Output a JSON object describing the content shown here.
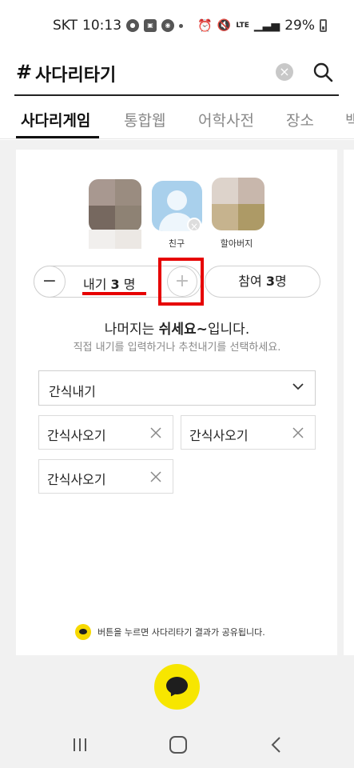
{
  "status_bar": {
    "carrier": "SKT",
    "time": "10:13",
    "network": "LTE",
    "battery": "29%"
  },
  "search": {
    "hash": "#",
    "query": "사다리타기"
  },
  "tabs": [
    {
      "label": "사다리게임",
      "active": true
    },
    {
      "label": "통합웹",
      "active": false
    },
    {
      "label": "어학사전",
      "active": false
    },
    {
      "label": "장소",
      "active": false
    },
    {
      "label": "백",
      "active": false
    }
  ],
  "participants": [
    {
      "label": ""
    },
    {
      "label": "친구"
    },
    {
      "label": "할아버지"
    }
  ],
  "stepper": {
    "prefix": "내기 ",
    "count": "3",
    "suffix": " 명",
    "minus": "−",
    "plus": "+"
  },
  "participants_button": {
    "prefix": "참여 ",
    "count": "3",
    "suffix": "명"
  },
  "message": {
    "before": "나머지는 ",
    "bold": "쉬세요~",
    "after": "입니다.",
    "sub": "직접 내기를 입력하거나 추천내기를 선택하세요."
  },
  "dropdown": {
    "selected": "간식내기"
  },
  "chips": [
    {
      "label": "간식사오기"
    },
    {
      "label": "간식사오기"
    },
    {
      "label": "간식사오기"
    }
  ],
  "share_note": "버튼을 누르면 사다리타기 결과가 공유됩니다.",
  "colors": {
    "accent_yellow": "#f7e600",
    "highlight_red": "#e60000",
    "background_gray": "#f1f1f1"
  }
}
